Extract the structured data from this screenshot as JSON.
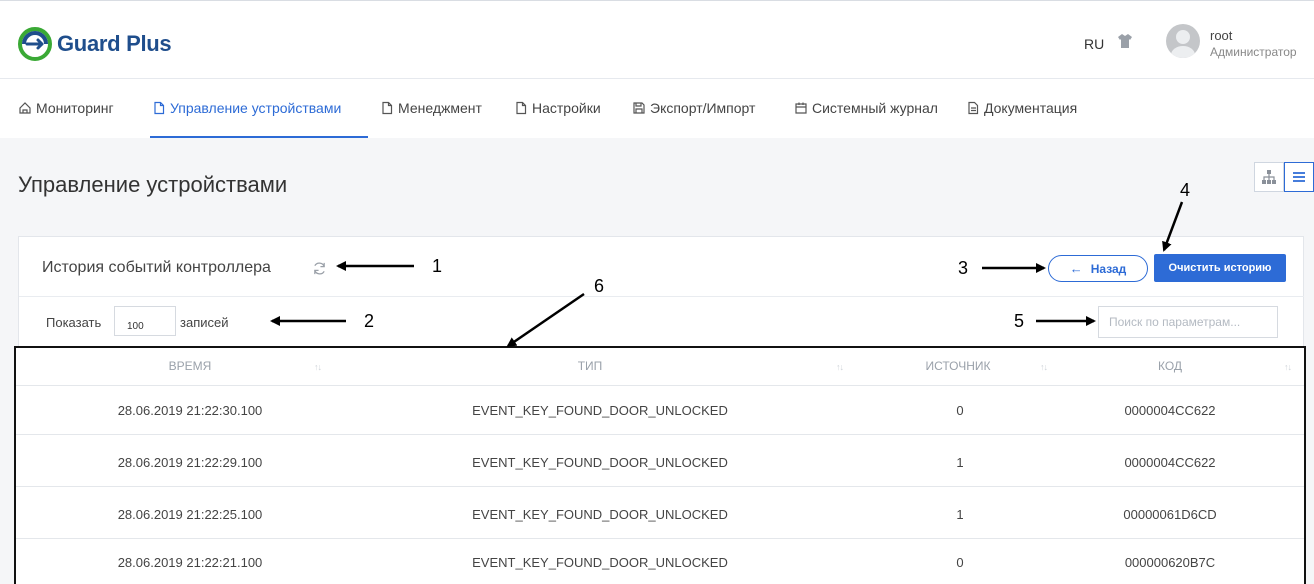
{
  "header": {
    "logo_text": "Guard Plus",
    "language": "RU",
    "user_name": "root",
    "user_role": "Администратор"
  },
  "nav": {
    "items": [
      {
        "label": "Мониторинг",
        "icon": "home-icon"
      },
      {
        "label": "Управление устройствами",
        "icon": "file-icon",
        "active": true
      },
      {
        "label": "Менеджмент",
        "icon": "file-icon"
      },
      {
        "label": "Настройки",
        "icon": "file-icon"
      },
      {
        "label": "Экспорт/Импорт",
        "icon": "save-icon"
      },
      {
        "label": "Системный журнал",
        "icon": "calendar-icon"
      },
      {
        "label": "Документация",
        "icon": "document-icon"
      }
    ]
  },
  "page": {
    "title": "Управление устройствами"
  },
  "card": {
    "title": "История событий контроллера",
    "back_label": "Назад",
    "clear_label": "Очистить историю",
    "show_label": "Показать",
    "page_size": "100",
    "records_label": "записей",
    "search_placeholder": "Поиск по параметрам..."
  },
  "table": {
    "columns": [
      "ВРЕМЯ",
      "ТИП",
      "ИСТОЧНИК",
      "КОД"
    ],
    "rows": [
      [
        "28.06.2019 21:22:30.100",
        "EVENT_KEY_FOUND_DOOR_UNLOCKED",
        "0",
        "0000004CC622"
      ],
      [
        "28.06.2019 21:22:29.100",
        "EVENT_KEY_FOUND_DOOR_UNLOCKED",
        "1",
        "0000004CC622"
      ],
      [
        "28.06.2019 21:22:25.100",
        "EVENT_KEY_FOUND_DOOR_UNLOCKED",
        "1",
        "00000061D6CD"
      ],
      [
        "28.06.2019 21:22:21.100",
        "EVENT_KEY_FOUND_DOOR_UNLOCKED",
        "0",
        "000000620B7C"
      ]
    ]
  },
  "annotations": [
    "1",
    "2",
    "3",
    "4",
    "5",
    "6"
  ],
  "colors": {
    "accent": "#2d6bd6",
    "logo_green": "#3aa935",
    "logo_blue": "#1f4e8c"
  }
}
